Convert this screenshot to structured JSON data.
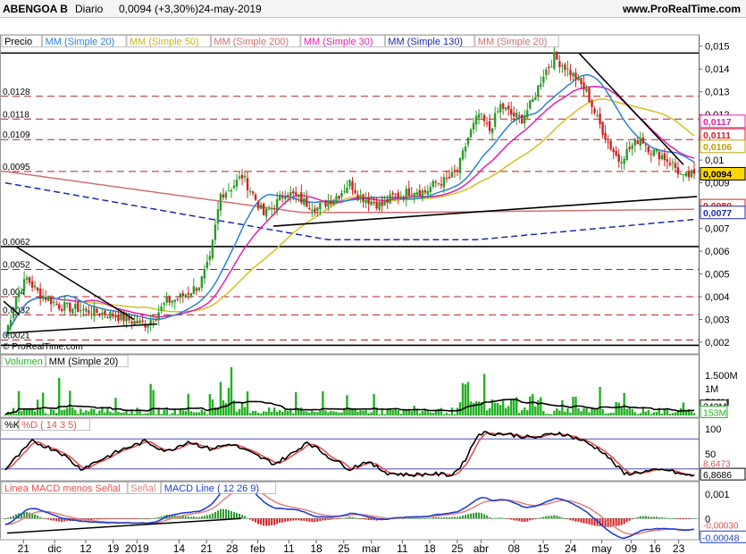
{
  "header": {
    "symbol": "ABENGOA B",
    "period": "Diario",
    "last": "0,0094 (+3,30%)",
    "date": "24-may-2019",
    "site": "www.ProRealTime.com"
  },
  "colors": {
    "up": "#2a9a2a",
    "down": "#d42020",
    "mm20": "#2a82d8",
    "mm50": "#d4c020",
    "mm200": "#d07070",
    "mm30": "#e020b0",
    "mm130": "#1a2ab0",
    "volume": "#22b022",
    "stoch_k": "#000000",
    "stoch_d": "#e05050",
    "macd_signal": "#e08080",
    "macd_line": "#2040d0"
  },
  "price_panel": {
    "indicator_labels": [
      {
        "text": "Precio",
        "color": "#000000"
      },
      {
        "text": "MM (Simple 20)",
        "color": "#2a82d8"
      },
      {
        "text": "MM (Simple 50)",
        "color": "#c8b418"
      },
      {
        "text": "MM (Simple 200)",
        "color": "#d07070"
      },
      {
        "text": "MM (Simple 30)",
        "color": "#e020b0"
      },
      {
        "text": "MM (Simple 130)",
        "color": "#1a2ab0"
      },
      {
        "text": "MM (Simple 20)",
        "color": "#d07070"
      }
    ],
    "axis_ticks": [
      "0,015",
      "0,014",
      "0,013",
      "0,012",
      "0,011",
      "0,01",
      "0,009",
      "0,008",
      "0,007",
      "0,006",
      "0,005",
      "0,004",
      "0,003",
      "0,002"
    ],
    "price_levels": [
      {
        "value": 0.0062,
        "label": "0,0062"
      },
      {
        "value": 0.0052,
        "label": "0,0052"
      },
      {
        "value": 0.004,
        "label": "0,004"
      },
      {
        "value": 0.0032,
        "label": "0,0032"
      },
      {
        "value": 0.0021,
        "label": "0,0021"
      },
      {
        "value": 0.0128,
        "label": "0,0128"
      },
      {
        "value": 0.0118,
        "label": "0,0118"
      },
      {
        "value": 0.0109,
        "label": "0,0109"
      },
      {
        "value": 0.0095,
        "label": "0,0095"
      },
      {
        "value": 0.0147,
        "label": ""
      }
    ],
    "value_boxes": [
      {
        "value": 0.0117,
        "label": "0,0117",
        "color": "#e020b0"
      },
      {
        "value": 0.0111,
        "label": "0,0111",
        "color": "#d42020"
      },
      {
        "value": 0.0106,
        "label": "0,0106",
        "color": "#b8a000"
      },
      {
        "value": 0.0094,
        "label": "0,0094",
        "color": "#000000"
      },
      {
        "value": 0.008,
        "label": "0,0080",
        "color": "#d42020"
      },
      {
        "value": 0.0077,
        "label": "0,0077",
        "color": "#1a2ab0"
      }
    ],
    "credit": "© ProRealTime.com"
  },
  "volume_panel": {
    "labels": [
      {
        "text": "Volumen",
        "color": "#22b022"
      },
      {
        "text": "MM (Simple 20)",
        "color": "#000000"
      }
    ],
    "axis_ticks": [
      "1.500M",
      "1M",
      "500M"
    ],
    "value_boxes": [
      {
        "label": "342M",
        "color": "#000000"
      },
      {
        "label": "153M",
        "color": "#22b022"
      }
    ]
  },
  "stoch_panel": {
    "labels": [
      {
        "text": "%K",
        "color": "#000000"
      },
      {
        "text": "%D ( 14 3 5)",
        "color": "#e05050"
      }
    ],
    "axis_ticks": [
      "100",
      "50"
    ],
    "value_boxes": [
      {
        "label": "8,6473",
        "color": "#e05050"
      },
      {
        "label": "6,8686",
        "color": "#000000"
      }
    ]
  },
  "macd_panel": {
    "labels": [
      {
        "text": "Linea MACD menos Señal",
        "color": "#e05050"
      },
      {
        "text": "Señal",
        "color": "#e08080"
      },
      {
        "text": "MACD Line ( 12 26 9)",
        "color": "#2040d0"
      }
    ],
    "axis_ticks": [
      "0,001",
      "0"
    ],
    "value_boxes": [
      {
        "label": "-0,00030",
        "color": "#e05050"
      },
      {
        "label": "-0,00048",
        "color": "#2040d0"
      }
    ]
  },
  "x_axis": {
    "ticks": [
      "21",
      "dic",
      "12",
      "19",
      "2019",
      "14",
      "21",
      "28",
      "feb",
      "11",
      "18",
      "25",
      "mar",
      "11",
      "18",
      "25",
      "abr",
      "08",
      "15",
      "24",
      "may",
      "09",
      "16",
      "23"
    ]
  },
  "chart_data": {
    "type": "candlestick",
    "symbol": "ABENGOA B",
    "date_range": [
      "2018-11-21",
      "2019-05-24"
    ],
    "last_close": 0.0094,
    "change_pct": 3.3,
    "ylim": [
      0.002,
      0.0155
    ],
    "price_path": [
      [
        0,
        0.0023
      ],
      [
        4,
        0.004
      ],
      [
        8,
        0.0048
      ],
      [
        12,
        0.0042
      ],
      [
        20,
        0.0036
      ],
      [
        30,
        0.0034
      ],
      [
        40,
        0.0032
      ],
      [
        48,
        0.0029
      ],
      [
        52,
        0.0028
      ],
      [
        56,
        0.0032
      ],
      [
        60,
        0.0038
      ],
      [
        64,
        0.0039
      ],
      [
        68,
        0.0042
      ],
      [
        72,
        0.0045
      ],
      [
        76,
        0.0056
      ],
      [
        80,
        0.0085
      ],
      [
        84,
        0.0088
      ],
      [
        88,
        0.0093
      ],
      [
        92,
        0.0085
      ],
      [
        96,
        0.0076
      ],
      [
        100,
        0.008
      ],
      [
        104,
        0.0086
      ],
      [
        108,
        0.0084
      ],
      [
        112,
        0.0081
      ],
      [
        116,
        0.0079
      ],
      [
        120,
        0.0082
      ],
      [
        124,
        0.0085
      ],
      [
        128,
        0.009
      ],
      [
        132,
        0.0084
      ],
      [
        136,
        0.0082
      ],
      [
        140,
        0.008
      ],
      [
        144,
        0.0084
      ],
      [
        148,
        0.0085
      ],
      [
        152,
        0.0087
      ],
      [
        156,
        0.0086
      ],
      [
        160,
        0.009
      ],
      [
        164,
        0.0091
      ],
      [
        168,
        0.0095
      ],
      [
        172,
        0.011
      ],
      [
        176,
        0.012
      ],
      [
        180,
        0.0113
      ],
      [
        184,
        0.0124
      ],
      [
        188,
        0.012
      ],
      [
        192,
        0.0118
      ],
      [
        196,
        0.0126
      ],
      [
        200,
        0.0138
      ],
      [
        204,
        0.0145
      ],
      [
        208,
        0.0141
      ],
      [
        212,
        0.0136
      ],
      [
        216,
        0.013
      ],
      [
        220,
        0.0118
      ],
      [
        224,
        0.0108
      ],
      [
        228,
        0.01
      ],
      [
        232,
        0.0105
      ],
      [
        236,
        0.011
      ],
      [
        240,
        0.0104
      ],
      [
        244,
        0.0102
      ],
      [
        248,
        0.0098
      ],
      [
        252,
        0.0092
      ],
      [
        256,
        0.0094
      ]
    ],
    "series": [
      {
        "name": "MM (Simple 20)",
        "last": 0.0111
      },
      {
        "name": "MM (Simple 50)",
        "last": 0.0106
      },
      {
        "name": "MM (Simple 200)",
        "last": 0.008
      },
      {
        "name": "MM (Simple 30)",
        "last": 0.0117
      },
      {
        "name": "MM (Simple 130)",
        "last": 0.0077
      }
    ],
    "volume": {
      "ylim": [
        0,
        1800
      ],
      "unit": "M",
      "mm20_last": 342,
      "last": 153
    },
    "stochastic": {
      "ylim": [
        0,
        105
      ],
      "k_last": 6.8686,
      "d_last": 8.6473
    },
    "macd": {
      "ylim": [
        -0.0008,
        0.0013
      ],
      "signal_last": -0.0003,
      "macd_last": -0.00048
    }
  }
}
